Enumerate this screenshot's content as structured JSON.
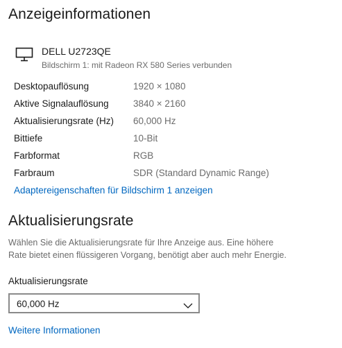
{
  "display_info": {
    "title": "Anzeigeinformationen",
    "monitor": {
      "icon": "monitor-icon",
      "name": "DELL U2723QE",
      "subtitle": "Bildschirm 1: mit Radeon RX 580 Series verbunden"
    },
    "rows": [
      {
        "label": "Desktopauflösung",
        "value": "1920 × 1080"
      },
      {
        "label": "Aktive Signalauflösung",
        "value": "3840 × 2160"
      },
      {
        "label": "Aktualisierungsrate (Hz)",
        "value": "60,000 Hz"
      },
      {
        "label": "Bittiefe",
        "value": "10-Bit"
      },
      {
        "label": "Farbformat",
        "value": "RGB"
      },
      {
        "label": "Farbraum",
        "value": "SDR (Standard Dynamic Range)"
      }
    ],
    "adapter_link": "Adaptereigenschaften für Bildschirm 1 anzeigen"
  },
  "refresh_rate": {
    "title": "Aktualisierungsrate",
    "description_line1": "Wählen Sie die Aktualisierungsrate für Ihre Anzeige aus. Eine höhere",
    "description_line2": "Rate bietet einen flüssigeren Vorgang, benötigt aber auch mehr Energie.",
    "field_label": "Aktualisierungsrate",
    "selected_value": "60,000 Hz",
    "more_info_link": "Weitere Informationen"
  },
  "colors": {
    "link": "#0067c0",
    "secondary_text": "#6b6b6b",
    "dropdown_border": "#8a8a8a"
  }
}
